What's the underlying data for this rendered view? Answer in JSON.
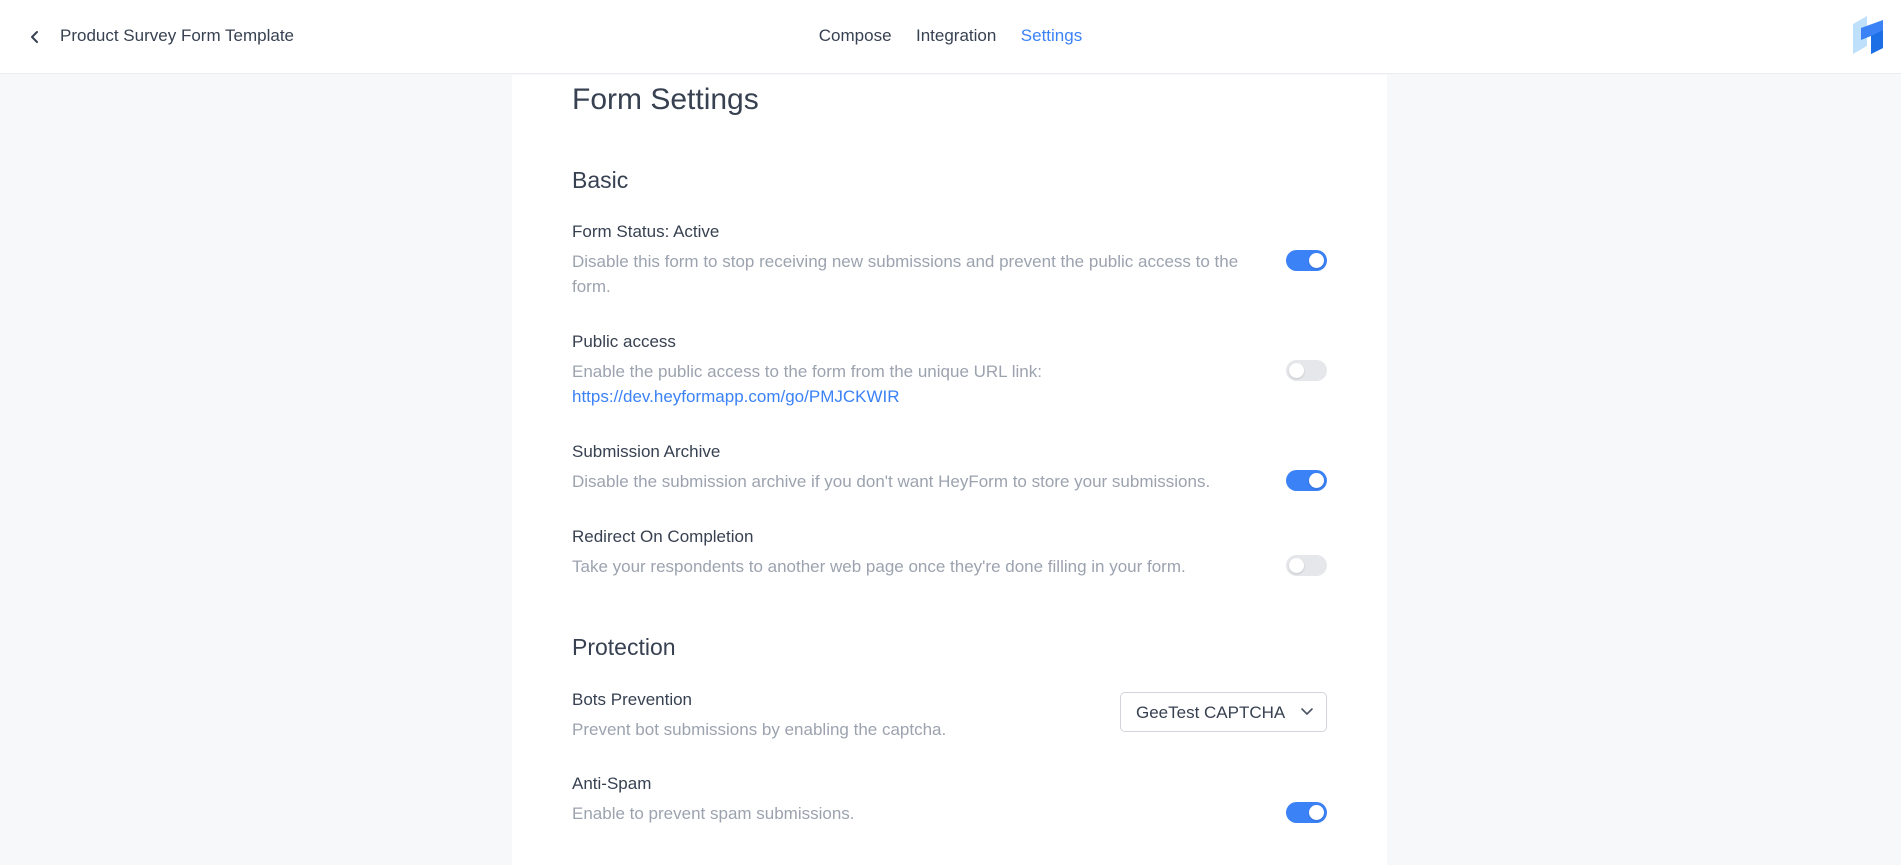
{
  "header": {
    "form_title": "Product Survey Form Template",
    "tabs": [
      {
        "label": "Compose",
        "active": false
      },
      {
        "label": "Integration",
        "active": false
      },
      {
        "label": "Settings",
        "active": true
      }
    ]
  },
  "page": {
    "title": "Form Settings"
  },
  "sections": {
    "basic": {
      "title": "Basic",
      "form_status": {
        "title": "Form Status: Active",
        "description": "Disable this form to stop receiving new submissions and prevent the public access to the form.",
        "enabled": true
      },
      "public_access": {
        "title": "Public access",
        "description": "Enable the public access to the form from the unique URL link:",
        "link": "https://dev.heyformapp.com/go/PMJCKWIR",
        "enabled": false
      },
      "submission_archive": {
        "title": "Submission Archive",
        "description": "Disable the submission archive if you don't want HeyForm to store your submissions.",
        "enabled": true
      },
      "redirect": {
        "title": "Redirect On Completion",
        "description": "Take your respondents to another web page once they're done filling in your form.",
        "enabled": false
      }
    },
    "protection": {
      "title": "Protection",
      "bots": {
        "title": "Bots Prevention",
        "description": "Prevent bot submissions by enabling the captcha.",
        "selected": "GeeTest CAPTCHA"
      },
      "anti_spam": {
        "title": "Anti-Spam",
        "description": "Enable to prevent spam submissions.",
        "enabled": true
      }
    }
  },
  "colors": {
    "accent": "#3b82f6",
    "toggle_off": "#e5e7eb",
    "muted_text": "#9ca3af"
  },
  "icons": {
    "back": "chevron-left-icon",
    "logo": "heyform-logo",
    "select": "chevron-down-icon"
  }
}
